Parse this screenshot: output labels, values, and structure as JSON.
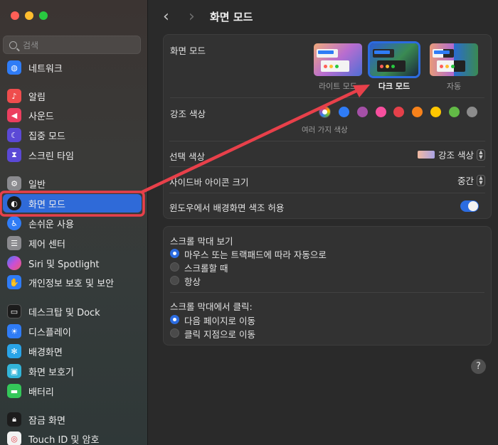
{
  "sidebar": {
    "search_placeholder": "검색",
    "items": [
      {
        "label": "네트워크",
        "icon": "globe-icon",
        "color": "#2f7cf6"
      },
      {
        "label": "알림",
        "icon": "bell-icon",
        "color": "#ef4d4d"
      },
      {
        "label": "사운드",
        "icon": "speaker-icon",
        "color": "#ec3f5f"
      },
      {
        "label": "집중 모드",
        "icon": "moon-icon",
        "color": "#5b49d6"
      },
      {
        "label": "스크린 타임",
        "icon": "hourglass-icon",
        "color": "#5b49d6"
      },
      {
        "label": "일반",
        "icon": "gear-icon",
        "color": "#8a8a8e"
      },
      {
        "label": "화면 모드",
        "icon": "appearance-icon",
        "color": "#1c1c1c"
      },
      {
        "label": "손쉬운 사용",
        "icon": "accessibility-icon",
        "color": "#2f7cf6"
      },
      {
        "label": "제어 센터",
        "icon": "control-center-icon",
        "color": "#8a8a8e"
      },
      {
        "label": "Siri 및 Spotlight",
        "icon": "siri-icon",
        "color": "#7a52d9"
      },
      {
        "label": "개인정보 보호 및 보안",
        "icon": "hand-icon",
        "color": "#2f7cf6"
      },
      {
        "label": "데스크탑 및 Dock",
        "icon": "dock-icon",
        "color": "#1c1c1c"
      },
      {
        "label": "디스플레이",
        "icon": "sun-icon",
        "color": "#2f7cf6"
      },
      {
        "label": "배경화면",
        "icon": "flower-icon",
        "color": "#29a4e8"
      },
      {
        "label": "화면 보호기",
        "icon": "screensaver-icon",
        "color": "#33b5d9"
      },
      {
        "label": "배터리",
        "icon": "battery-icon",
        "color": "#34c759"
      },
      {
        "label": "잠금 화면",
        "icon": "lock-icon",
        "color": "#1c1c1c"
      },
      {
        "label": "Touch ID 및 암호",
        "icon": "fingerprint-icon",
        "color": "#f2f2f2"
      }
    ]
  },
  "header": {
    "title": "화면 모드"
  },
  "appearance": {
    "label": "화면 모드",
    "options": [
      "라이트 모드",
      "다크 모드",
      "자동"
    ],
    "selected": "다크 모드"
  },
  "accent": {
    "label": "강조 색상",
    "caption": "여러 가지 색상",
    "colors": [
      "multicolor",
      "#2f7cf6",
      "#a550a7",
      "#f74f9e",
      "#e5404a",
      "#f7821b",
      "#ffc600",
      "#62ba46",
      "#8c8c8c"
    ]
  },
  "highlight": {
    "label": "선택 색상",
    "value": "강조 색상"
  },
  "sidebar_icon_size": {
    "label": "사이드바 아이콘 크기",
    "value": "중간"
  },
  "wallpaper_tinting": {
    "label": "윈도우에서 배경화면 색조 허용",
    "enabled": true
  },
  "scrollbars": {
    "label": "스크롤 막대 보기",
    "options": [
      "마우스 또는 트랙패드에 따라 자동으로",
      "스크롤할 때",
      "항상"
    ],
    "selected_index": 0
  },
  "scroll_click": {
    "label": "스크롤 막대에서 클릭:",
    "options": [
      "다음 페이지로 이동",
      "클릭 지점으로 이동"
    ],
    "selected_index": 0
  },
  "colors": {
    "annotation": "#e8404a",
    "accent_blue": "#2c6ce0"
  }
}
